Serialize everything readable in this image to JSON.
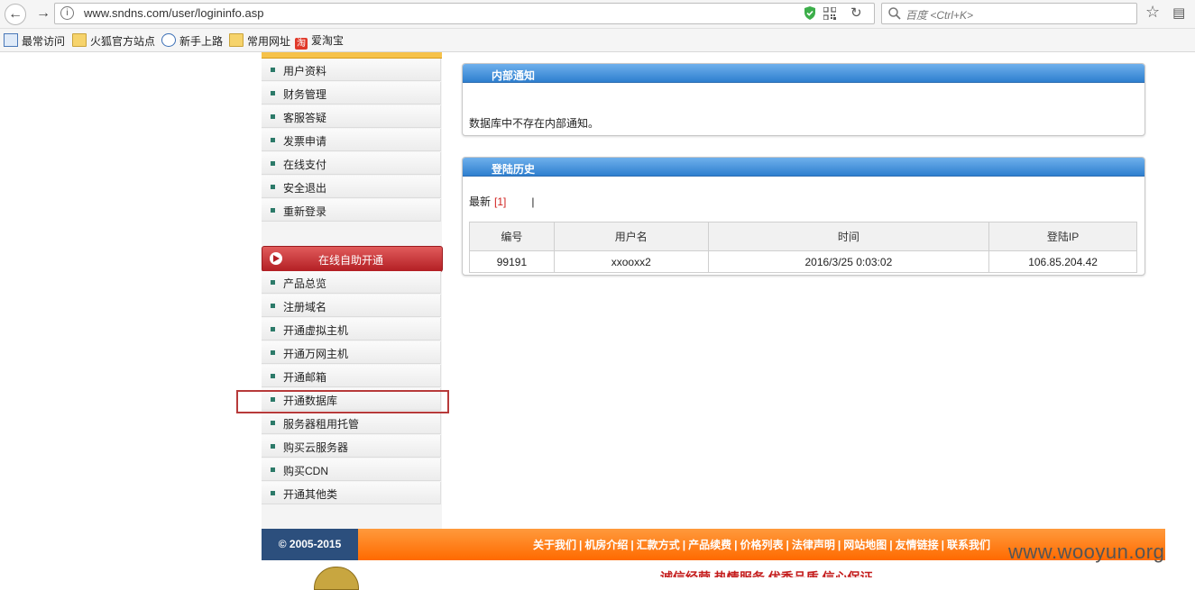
{
  "browser": {
    "url": "www.sndns.com/user/logininfo.asp",
    "search_placeholder": "百度 <Ctrl+K>",
    "bookmarks": [
      "最常访问",
      "火狐官方站点",
      "新手上路",
      "常用网址",
      "爱淘宝"
    ],
    "taobao_icon_text": "淘"
  },
  "menu": {
    "items_top": [
      "用户资料",
      "财务管理",
      "客服答疑",
      "发票申请",
      "在线支付",
      "安全退出",
      "重新登录"
    ],
    "section_title": "在线自助开通",
    "items_bottom": [
      "产品总览",
      "注册域名",
      "开通虚拟主机",
      "开通万网主机",
      "开通邮箱",
      "开通数据库",
      "服务器租用托管",
      "购买云服务器",
      "购买CDN",
      "开通其他类"
    ]
  },
  "notice": {
    "title": "内部通知",
    "text": "数据库中不存在内部通知。"
  },
  "history": {
    "title": "登陆历史",
    "latest_label": "最新",
    "page_link": "[1]",
    "separator": "|",
    "columns": [
      "编号",
      "用户名",
      "时间",
      "登陆IP"
    ],
    "rows": [
      [
        "99191",
        "xxooxx2",
        "2016/3/25 0:03:02",
        "106.85.204.42"
      ]
    ]
  },
  "footer": {
    "copyright": "© 2005-2015",
    "links": [
      "关于我们",
      "机房介绍",
      "汇款方式",
      "产品续费",
      "价格列表",
      "法律声明",
      "网站地图",
      "友情链接",
      "联系我们"
    ],
    "slogan": "诚信经营  热情服务  优秀品质  信心保证"
  },
  "watermark": "www.wooyun.org",
  "colors": {
    "panel_header": "#2e7fcf",
    "section_header": "#b31f24",
    "footer_orange": "#ff6a00",
    "footer_navy": "#2c4f7d",
    "highlight_box": "#b73a3a"
  }
}
